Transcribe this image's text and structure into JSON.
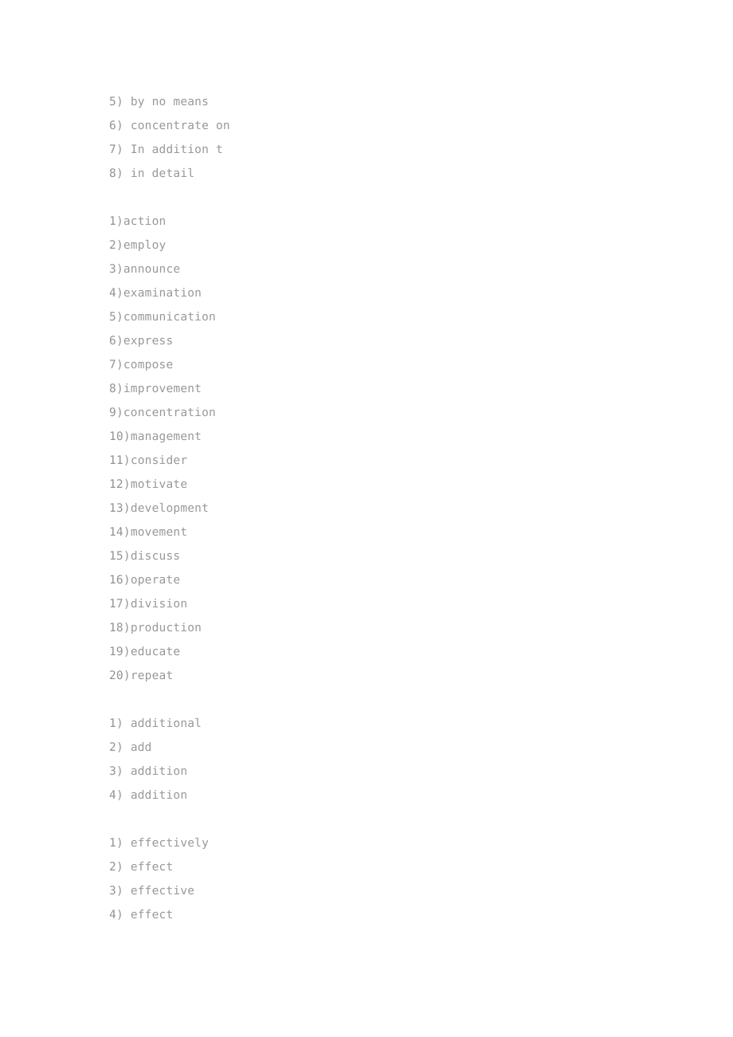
{
  "document": {
    "kind": "answer-key",
    "background_color": "#ffffff",
    "text_color": "#8d8d8d",
    "blocks": [
      {
        "id": "phrases",
        "separator": ") ",
        "items": [
          {
            "number": "5",
            "text": "by no means"
          },
          {
            "number": "6",
            "text": "concentrate on"
          },
          {
            "number": "7",
            "text": "In addition t"
          },
          {
            "number": "8",
            "text": "in detail"
          }
        ]
      },
      {
        "id": "word-forms",
        "separator": ")",
        "items": [
          {
            "number": "1",
            "text": "action"
          },
          {
            "number": "2",
            "text": "employ"
          },
          {
            "number": "3",
            "text": "announce"
          },
          {
            "number": "4",
            "text": "examination"
          },
          {
            "number": "5",
            "text": "communication"
          },
          {
            "number": "6",
            "text": "express"
          },
          {
            "number": "7",
            "text": "compose"
          },
          {
            "number": "8",
            "text": "improvement"
          },
          {
            "number": "9",
            "text": "concentration"
          },
          {
            "number": "10",
            "text": "management"
          },
          {
            "number": "11",
            "text": "consider"
          },
          {
            "number": "12",
            "text": "motivate"
          },
          {
            "number": "13",
            "text": "development"
          },
          {
            "number": "14",
            "text": "movement"
          },
          {
            "number": "15",
            "text": "discuss"
          },
          {
            "number": "16",
            "text": "operate"
          },
          {
            "number": "17",
            "text": "division"
          },
          {
            "number": "18",
            "text": "production"
          },
          {
            "number": "19",
            "text": "educate"
          },
          {
            "number": "20",
            "text": "repeat"
          }
        ]
      },
      {
        "id": "addition-family",
        "separator": ") ",
        "items": [
          {
            "number": "1",
            "text": "additional"
          },
          {
            "number": "2",
            "text": "add"
          },
          {
            "number": "3",
            "text": "addition"
          },
          {
            "number": "4",
            "text": "addition"
          }
        ]
      },
      {
        "id": "effect-family",
        "separator": ") ",
        "items": [
          {
            "number": "1",
            "text": "effectively"
          },
          {
            "number": "2",
            "text": "effect"
          },
          {
            "number": "3",
            "text": "effective"
          },
          {
            "number": "4",
            "text": "effect"
          }
        ]
      }
    ]
  }
}
